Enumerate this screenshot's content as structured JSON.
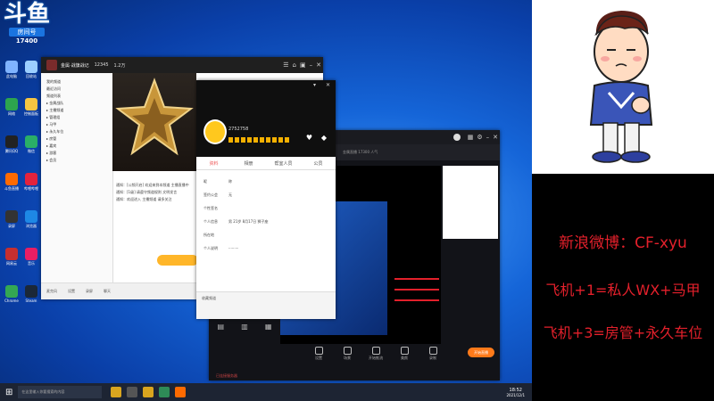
{
  "desktop": {
    "logo": {
      "mark": "斗鱼",
      "badge": "房间号",
      "number": "17400"
    },
    "icons": [
      {
        "label": "此电脑",
        "color": "#7fb3ff"
      },
      {
        "label": "回收站",
        "color": "#9ccfff"
      },
      {
        "label": "网络",
        "color": "#2da44e"
      },
      {
        "label": "控制面板",
        "color": "#f5c542"
      },
      {
        "label": "腾讯QQ",
        "color": "#222222"
      },
      {
        "label": "微信",
        "color": "#2aae67"
      },
      {
        "label": "斗鱼直播",
        "color": "#ff6a00"
      },
      {
        "label": "哔哩哔哩",
        "color": "#e2233d"
      },
      {
        "label": "录屏",
        "color": "#333333"
      },
      {
        "label": "浏览器",
        "color": "#1e88e5"
      },
      {
        "label": "网易云",
        "color": "#c62f2f"
      },
      {
        "label": "音乐",
        "color": "#e91e63"
      },
      {
        "label": "Chrome",
        "color": "#34a853"
      },
      {
        "label": "Steam",
        "color": "#1b2838"
      }
    ]
  },
  "yy": {
    "title_text": "金属·战旗战记",
    "room_count": "12345",
    "users": "1.2万",
    "contacts": [
      "我的频道",
      "最近访问",
      "频道列表",
      "▸ 金属战队",
      "▸ 主播频道",
      "▸ 管理组",
      "▸ 马甲",
      "▸ 永久车位",
      "▸ 房管",
      "▸ 嘉宾",
      "▸ 游客",
      "▸ 会员"
    ],
    "messages": [
      "通知：[公频开启] 欢迎来到本频道 主播直播中",
      "通知：[1级] 请遵守频道规则 文明发言",
      "通知：欢迎进入 主播频道 请多关注"
    ],
    "bottom_items": [
      "麦克风",
      "设置",
      "录屏",
      "聊天"
    ]
  },
  "profile": {
    "user_id": "2752758",
    "tabs": [
      "资料",
      "相册",
      "帮室人员",
      "公员"
    ],
    "fields": [
      {
        "label": "昵",
        "value": "称"
      },
      {
        "label": "签约公会",
        "value": "无"
      },
      {
        "label": "个性签名",
        "value": ""
      },
      {
        "label": "个人信息",
        "value": "男   21岁   8月17日   狮子座"
      },
      {
        "label": "所在地",
        "value": ""
      },
      {
        "label": "个人说明",
        "value": "·········"
      }
    ],
    "footer": "收藏频道"
  },
  "obs": {
    "title_text": "金属直播  17300  人气",
    "buttons": [
      "设置",
      "场景",
      "开始推流",
      "美颜",
      "录制"
    ],
    "start_label": "开始直播",
    "status": "已连接服务器"
  },
  "taskbar": {
    "search_placeholder": "在这里输入你要搜索的内容",
    "time": "18:52",
    "date": "2021/12/1"
  },
  "right_panel": {
    "weibo": "新浪微博：CF-xyu",
    "line2": "飞机+1=私人WX+马甲",
    "line3": "飞机+3=房管+永久车位"
  }
}
